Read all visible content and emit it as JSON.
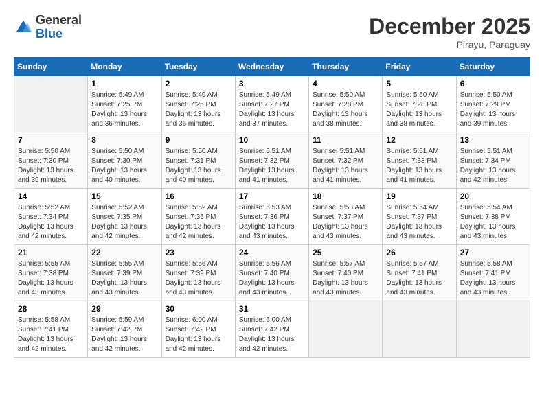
{
  "logo": {
    "general": "General",
    "blue": "Blue"
  },
  "header": {
    "month": "December 2025",
    "location": "Pirayu, Paraguay"
  },
  "days_of_week": [
    "Sunday",
    "Monday",
    "Tuesday",
    "Wednesday",
    "Thursday",
    "Friday",
    "Saturday"
  ],
  "weeks": [
    [
      {
        "day": "",
        "empty": true
      },
      {
        "day": "1",
        "sunrise": "5:49 AM",
        "sunset": "7:25 PM",
        "daylight": "13 hours and 36 minutes."
      },
      {
        "day": "2",
        "sunrise": "5:49 AM",
        "sunset": "7:26 PM",
        "daylight": "13 hours and 36 minutes."
      },
      {
        "day": "3",
        "sunrise": "5:49 AM",
        "sunset": "7:27 PM",
        "daylight": "13 hours and 37 minutes."
      },
      {
        "day": "4",
        "sunrise": "5:50 AM",
        "sunset": "7:28 PM",
        "daylight": "13 hours and 38 minutes."
      },
      {
        "day": "5",
        "sunrise": "5:50 AM",
        "sunset": "7:28 PM",
        "daylight": "13 hours and 38 minutes."
      },
      {
        "day": "6",
        "sunrise": "5:50 AM",
        "sunset": "7:29 PM",
        "daylight": "13 hours and 39 minutes."
      }
    ],
    [
      {
        "day": "7",
        "sunrise": "5:50 AM",
        "sunset": "7:30 PM",
        "daylight": "13 hours and 39 minutes."
      },
      {
        "day": "8",
        "sunrise": "5:50 AM",
        "sunset": "7:30 PM",
        "daylight": "13 hours and 40 minutes."
      },
      {
        "day": "9",
        "sunrise": "5:50 AM",
        "sunset": "7:31 PM",
        "daylight": "13 hours and 40 minutes."
      },
      {
        "day": "10",
        "sunrise": "5:51 AM",
        "sunset": "7:32 PM",
        "daylight": "13 hours and 41 minutes."
      },
      {
        "day": "11",
        "sunrise": "5:51 AM",
        "sunset": "7:32 PM",
        "daylight": "13 hours and 41 minutes."
      },
      {
        "day": "12",
        "sunrise": "5:51 AM",
        "sunset": "7:33 PM",
        "daylight": "13 hours and 41 minutes."
      },
      {
        "day": "13",
        "sunrise": "5:51 AM",
        "sunset": "7:34 PM",
        "daylight": "13 hours and 42 minutes."
      }
    ],
    [
      {
        "day": "14",
        "sunrise": "5:52 AM",
        "sunset": "7:34 PM",
        "daylight": "13 hours and 42 minutes."
      },
      {
        "day": "15",
        "sunrise": "5:52 AM",
        "sunset": "7:35 PM",
        "daylight": "13 hours and 42 minutes."
      },
      {
        "day": "16",
        "sunrise": "5:52 AM",
        "sunset": "7:35 PM",
        "daylight": "13 hours and 42 minutes."
      },
      {
        "day": "17",
        "sunrise": "5:53 AM",
        "sunset": "7:36 PM",
        "daylight": "13 hours and 43 minutes."
      },
      {
        "day": "18",
        "sunrise": "5:53 AM",
        "sunset": "7:37 PM",
        "daylight": "13 hours and 43 minutes."
      },
      {
        "day": "19",
        "sunrise": "5:54 AM",
        "sunset": "7:37 PM",
        "daylight": "13 hours and 43 minutes."
      },
      {
        "day": "20",
        "sunrise": "5:54 AM",
        "sunset": "7:38 PM",
        "daylight": "13 hours and 43 minutes."
      }
    ],
    [
      {
        "day": "21",
        "sunrise": "5:55 AM",
        "sunset": "7:38 PM",
        "daylight": "13 hours and 43 minutes."
      },
      {
        "day": "22",
        "sunrise": "5:55 AM",
        "sunset": "7:39 PM",
        "daylight": "13 hours and 43 minutes."
      },
      {
        "day": "23",
        "sunrise": "5:56 AM",
        "sunset": "7:39 PM",
        "daylight": "13 hours and 43 minutes."
      },
      {
        "day": "24",
        "sunrise": "5:56 AM",
        "sunset": "7:40 PM",
        "daylight": "13 hours and 43 minutes."
      },
      {
        "day": "25",
        "sunrise": "5:57 AM",
        "sunset": "7:40 PM",
        "daylight": "13 hours and 43 minutes."
      },
      {
        "day": "26",
        "sunrise": "5:57 AM",
        "sunset": "7:41 PM",
        "daylight": "13 hours and 43 minutes."
      },
      {
        "day": "27",
        "sunrise": "5:58 AM",
        "sunset": "7:41 PM",
        "daylight": "13 hours and 43 minutes."
      }
    ],
    [
      {
        "day": "28",
        "sunrise": "5:58 AM",
        "sunset": "7:41 PM",
        "daylight": "13 hours and 42 minutes."
      },
      {
        "day": "29",
        "sunrise": "5:59 AM",
        "sunset": "7:42 PM",
        "daylight": "13 hours and 42 minutes."
      },
      {
        "day": "30",
        "sunrise": "6:00 AM",
        "sunset": "7:42 PM",
        "daylight": "13 hours and 42 minutes."
      },
      {
        "day": "31",
        "sunrise": "6:00 AM",
        "sunset": "7:42 PM",
        "daylight": "13 hours and 42 minutes."
      },
      {
        "day": "",
        "empty": true
      },
      {
        "day": "",
        "empty": true
      },
      {
        "day": "",
        "empty": true
      }
    ]
  ],
  "labels": {
    "sunrise": "Sunrise:",
    "sunset": "Sunset:",
    "daylight": "Daylight:"
  }
}
